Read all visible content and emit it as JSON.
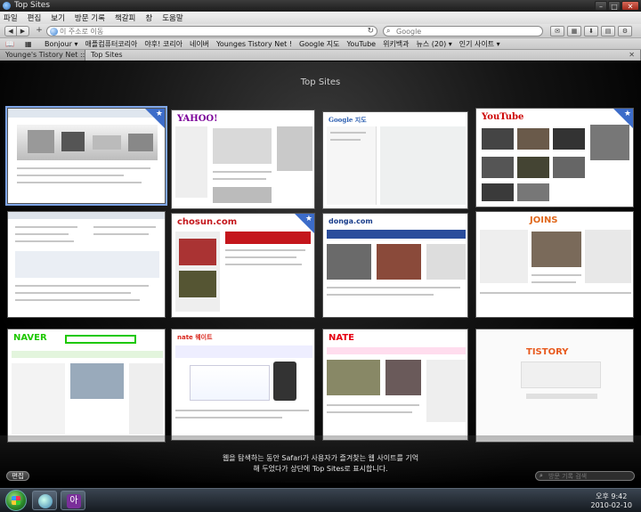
{
  "window": {
    "title": "Top Sites"
  },
  "menu": [
    "파일",
    "편집",
    "보기",
    "방문 기록",
    "책갈피",
    "창",
    "도움말"
  ],
  "toolbar": {
    "url_placeholder": "이 주소로 이동",
    "search_placeholder": "Google"
  },
  "bookmarks": [
    "Bonjour ▾",
    "애플컴퓨터코리아",
    "야후! 코리아",
    "네이버",
    "Younges Tistory Net !",
    "Google 지도",
    "YouTube",
    "위키백과",
    "뉴스 (20) ▾",
    "인기 사이트 ▾"
  ],
  "tabs": [
    {
      "label": "Younge's Tistory Net :: ..."
    },
    {
      "label": "Top Sites"
    }
  ],
  "topsites": {
    "title": "Top Sites",
    "thumbs": [
      {
        "site": ""
      },
      {
        "site": "YAHOO!"
      },
      {
        "site": "Google 지도"
      },
      {
        "site": "YouTube"
      },
      {
        "site": ""
      },
      {
        "site": "chosun.com"
      },
      {
        "site": "donga.com"
      },
      {
        "site": "JOINS"
      },
      {
        "site": "NAVER"
      },
      {
        "site": "nate 웨이트"
      },
      {
        "site": "NATE"
      },
      {
        "site": "TISTORY"
      }
    ],
    "caption_line1": "웹을 탐색하는 동안 Safari가 사용자가 즐겨찾는 웹 사이트를 기억",
    "caption_line2": "해 두었다가 상단에 Top Sites로 표시합니다.",
    "edit_label": "편집",
    "history_placeholder": "방문 기록 검색"
  },
  "taskbar": {
    "time": "오후 9:42",
    "date": "2010-02-10",
    "korean_icon": "아"
  },
  "colors": {
    "star": "#3c6cc9",
    "selected": "#7fa6e8"
  }
}
